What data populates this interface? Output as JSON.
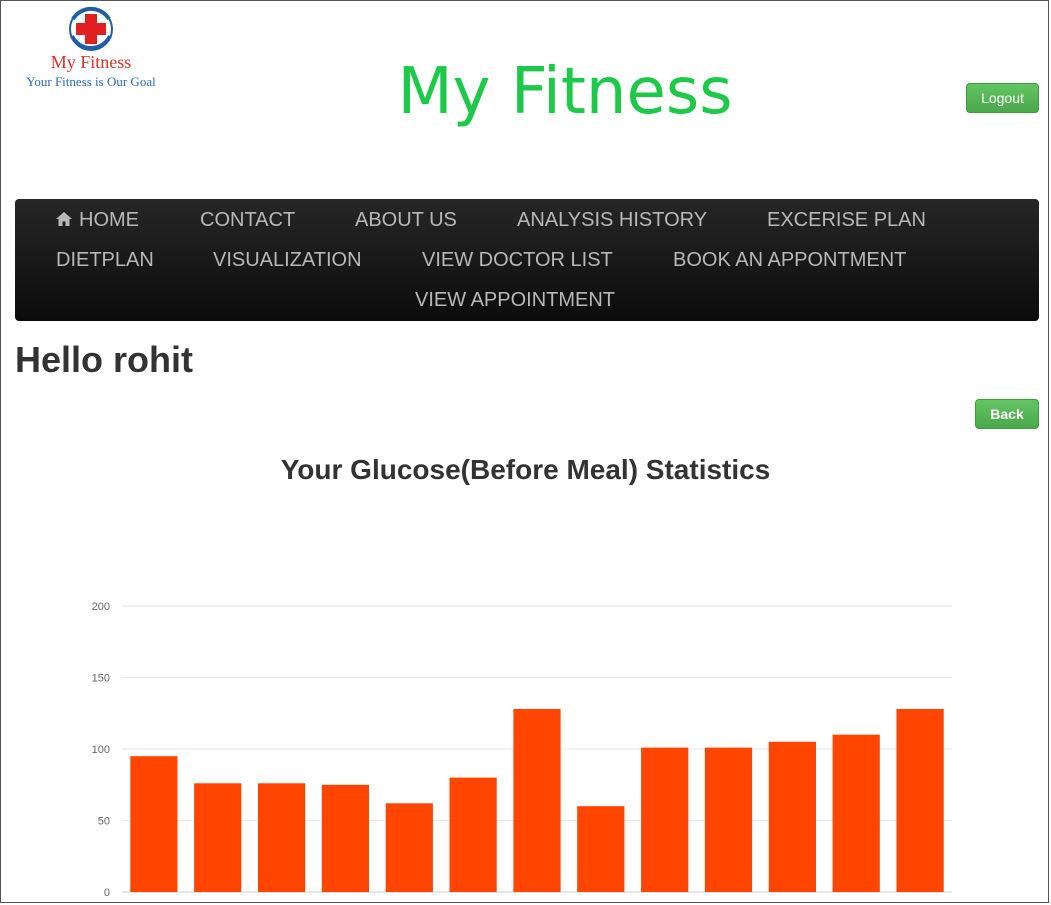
{
  "header": {
    "logo": {
      "name": "My Fitness",
      "tagline": "Your Fitness is Our Goal"
    },
    "title": "My Fitness",
    "logout_label": "Logout"
  },
  "nav": {
    "items": [
      {
        "label": "HOME",
        "icon": "home-icon"
      },
      {
        "label": "CONTACT"
      },
      {
        "label": "ABOUT US"
      },
      {
        "label": "ANALYSIS HISTORY"
      },
      {
        "label": "EXCERISE PLAN"
      },
      {
        "label": "DIETPLAN"
      },
      {
        "label": "VISUALIZATION"
      },
      {
        "label": "VIEW DOCTOR LIST"
      },
      {
        "label": "BOOK AN APPONTMENT"
      },
      {
        "label": "VIEW APPOINTMENT"
      }
    ]
  },
  "main": {
    "greeting": "Hello rohit",
    "back_label": "Back",
    "chart_title": "Your Glucose(Before Meal) Statistics"
  },
  "colors": {
    "title_green": "#1ec94a",
    "bar_color": "#ff4500",
    "nav_text": "#b8b8b8",
    "button_green": "#5cb85c"
  },
  "chart_data": {
    "type": "bar",
    "title": "Your Glucose(Before Meal) Statistics",
    "ylim": [
      0,
      200
    ],
    "yticks": [
      "0",
      "50",
      "100",
      "150",
      "200"
    ],
    "grid": true,
    "values": [
      95,
      76,
      76,
      75,
      62,
      80,
      128,
      60,
      101,
      101,
      105,
      110,
      128
    ]
  }
}
